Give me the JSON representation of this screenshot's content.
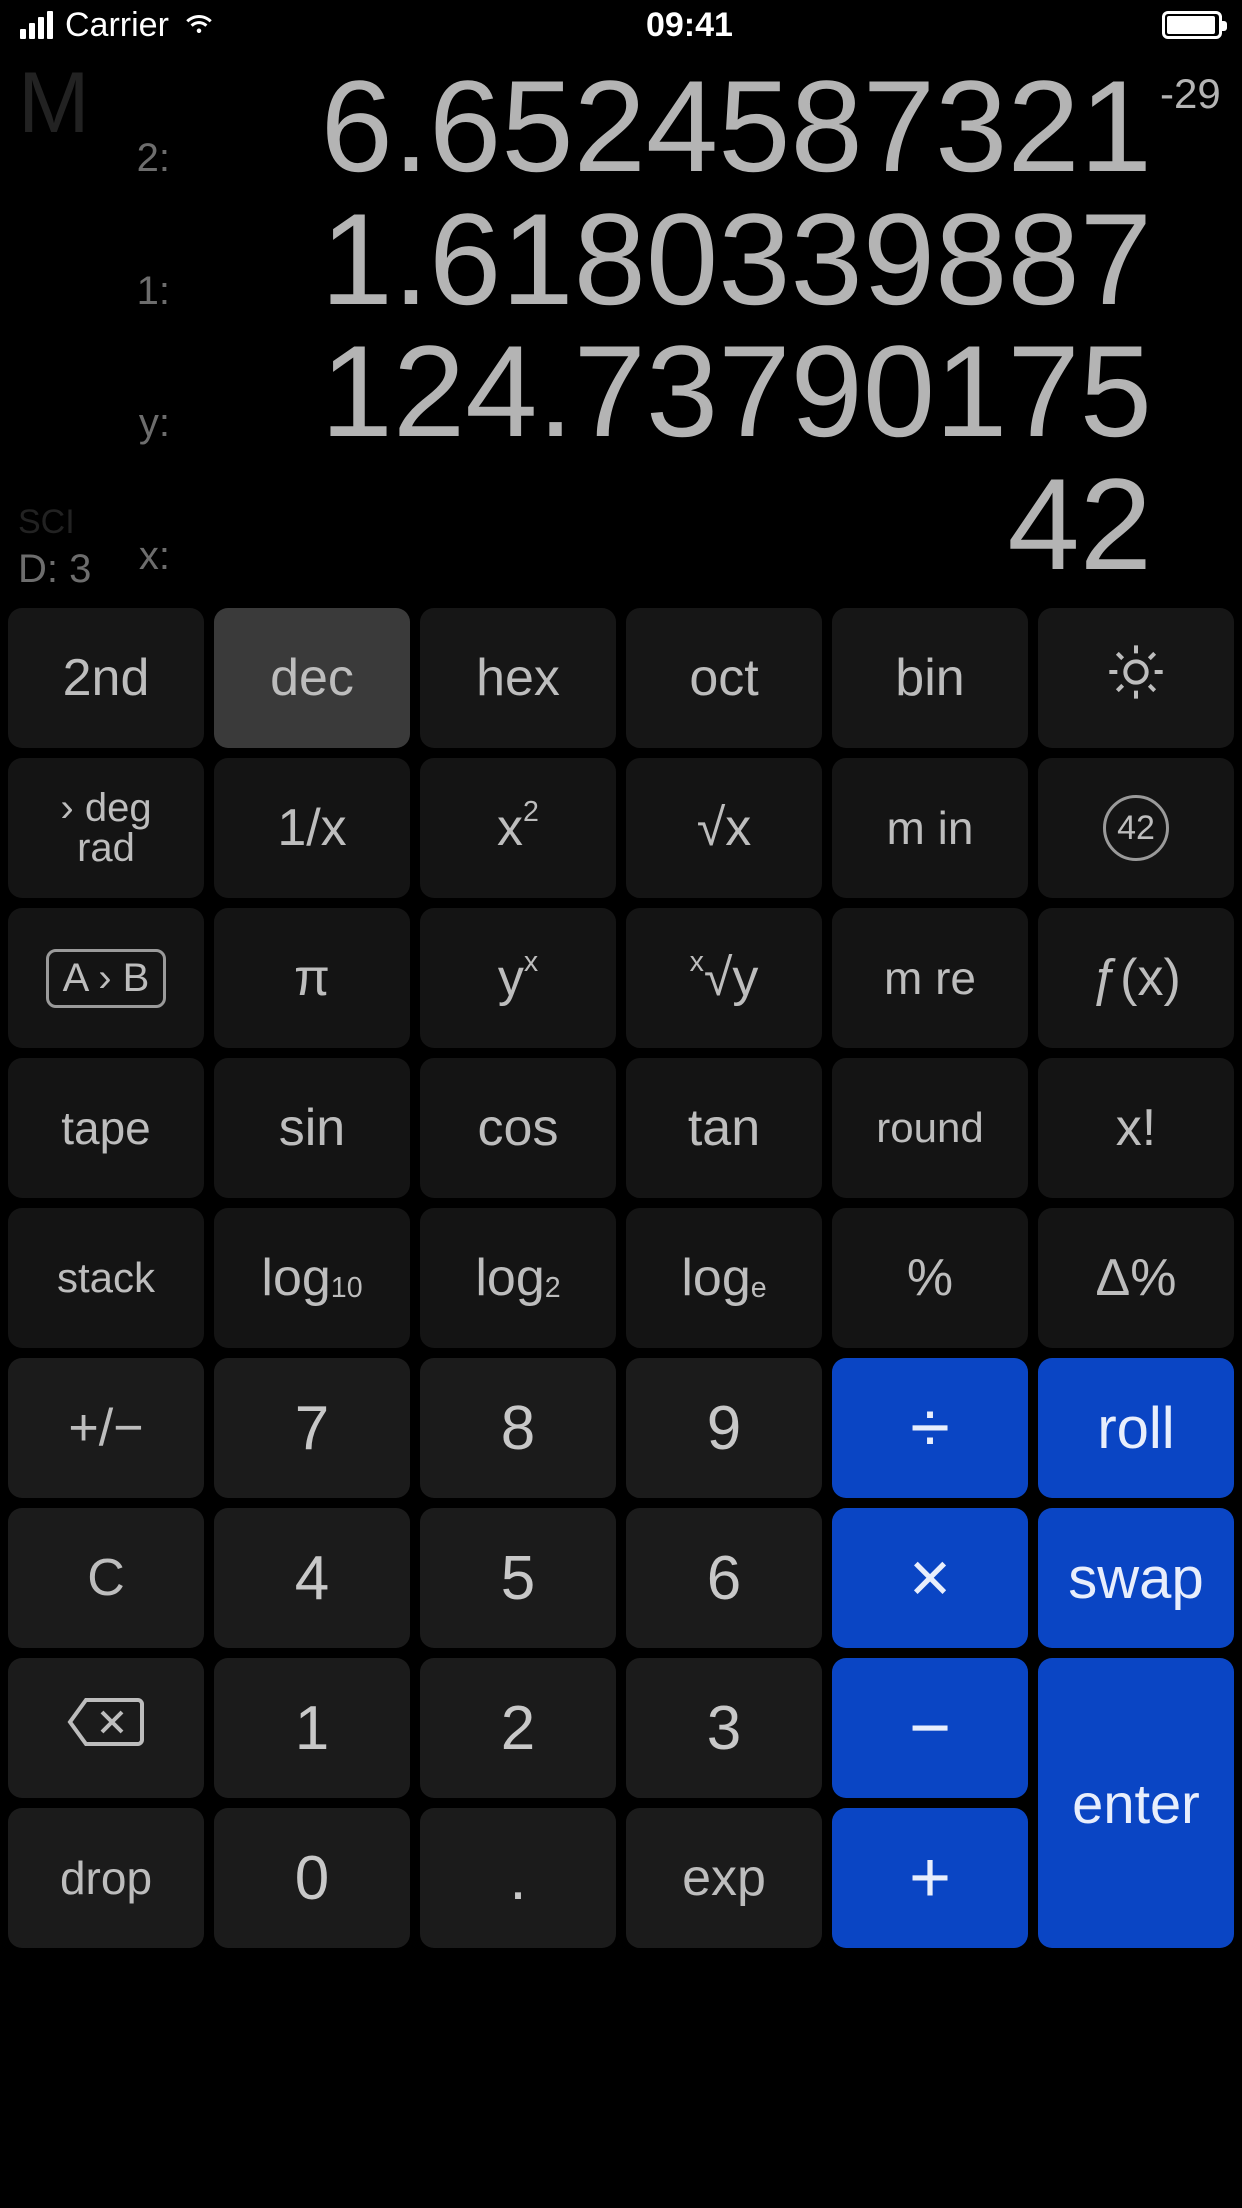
{
  "status": {
    "carrier": "Carrier",
    "time": "09:41"
  },
  "display": {
    "mem_indicator": "M",
    "sci_label": "SCI",
    "d_label": "D: 3",
    "rows": [
      {
        "label": "2:",
        "value": "6.6524587321",
        "exp": "-29"
      },
      {
        "label": "1:",
        "value": "1.6180339887",
        "exp": ""
      },
      {
        "label": "y:",
        "value": "124.73790175",
        "exp": ""
      },
      {
        "label": "x:",
        "value": "42",
        "exp": ""
      }
    ]
  },
  "modes": {
    "second": "2nd",
    "dec": "dec",
    "hex": "hex",
    "oct": "oct",
    "bin": "bin"
  },
  "keys": {
    "deg_line1": "› deg",
    "deg_line2": "rad",
    "inv": "1/x",
    "sq_base": "x",
    "sq_sup": "2",
    "sqrt": "√x",
    "min": "m in",
    "ab": "A › B",
    "pi": "π",
    "yx_base": "y",
    "yx_sup": "x",
    "xrt_sup": "x",
    "xrt_rad": "√y",
    "mre": "m re",
    "fx": "ƒ(x)",
    "tape": "tape",
    "sin": "sin",
    "cos": "cos",
    "tan": "tan",
    "round": "round",
    "fact": "x!",
    "stack": "stack",
    "log10_base": "log",
    "log10_sub": "10",
    "log2_base": "log",
    "log2_sub": "2",
    "loge_base": "log",
    "loge_sub": "e",
    "percent": "%",
    "dpercent": "Δ%",
    "pm": "+/−",
    "d7": "7",
    "d8": "8",
    "d9": "9",
    "div": "÷",
    "roll": "roll",
    "clear": "C",
    "d4": "4",
    "d5": "5",
    "d6": "6",
    "mul": "×",
    "swap": "swap",
    "d1": "1",
    "d2": "2",
    "d3": "3",
    "minus": "−",
    "enter": "enter",
    "drop": "drop",
    "d0": "0",
    "dot": ".",
    "exp": "exp",
    "plus": "+",
    "circ42": "42"
  }
}
